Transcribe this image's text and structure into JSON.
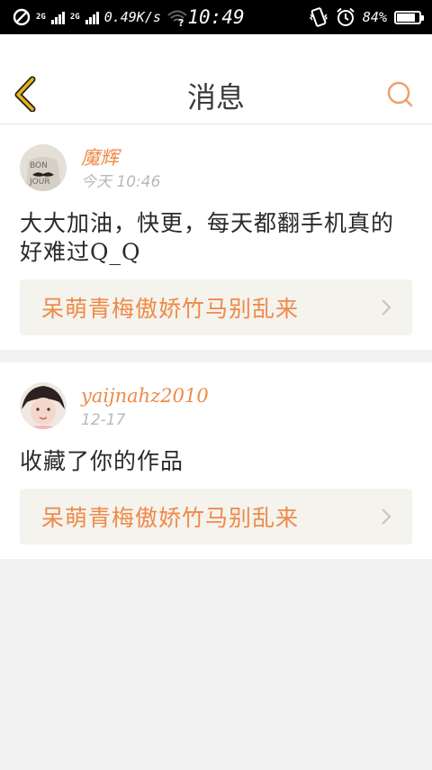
{
  "status_bar": {
    "network_label_1": "2G",
    "network_label_2": "2G",
    "speed": "0.49K/s",
    "time": "10:49",
    "battery": "84%",
    "battery_level": 0.84,
    "icons": [
      "block-icon",
      "signal-icon",
      "wifi-icon",
      "vibrate-icon",
      "alarm-icon",
      "battery-icon"
    ]
  },
  "header": {
    "title": "消息",
    "back_icon": "chevron-left-icon",
    "search_icon": "search-icon"
  },
  "colors": {
    "accent": "#ef8a47",
    "back_icon": "#e8b21a",
    "card_link_bg": "#f4f3ee",
    "page_bg": "#f2f2f2"
  },
  "messages": [
    {
      "username": "魔辉",
      "time": "今天 10:46",
      "content": "大大加油，快更，每天都翻手机真的好难过Q_Q",
      "book_title": "呆萌青梅傲娇竹马别乱来",
      "avatar_text": "BON JOUR"
    },
    {
      "username": "yaijnahz2010",
      "time": "12-17",
      "content": "收藏了你的作品",
      "book_title": "呆萌青梅傲娇竹马别乱来"
    }
  ]
}
